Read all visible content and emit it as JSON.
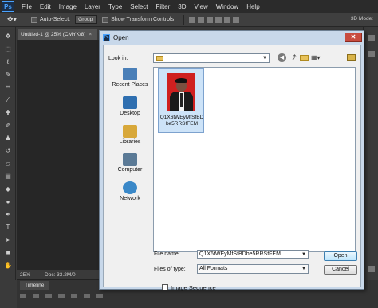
{
  "app": {
    "logo": "Ps",
    "menu": [
      "File",
      "Edit",
      "Image",
      "Layer",
      "Type",
      "Select",
      "Filter",
      "3D",
      "View",
      "Window",
      "Help"
    ]
  },
  "options_bar": {
    "auto_select_label": "Auto-Select:",
    "auto_select_value": "Group",
    "show_transform_label": "Show Transform Controls",
    "mode_3d_label": "3D Mode:"
  },
  "document": {
    "tab_title": "Untitled-1 @ 25% (CMYK/8)",
    "zoom": "25%",
    "doc_size": "Doc: 33.2M/0"
  },
  "timeline": {
    "tab_label": "Timeline"
  },
  "dialog": {
    "title": "Open",
    "close_glyph": "✕",
    "look_in_label": "Look in:",
    "look_in_value": "",
    "places": [
      {
        "label": "Recent Places",
        "icon": "recent-places-icon",
        "color": "#4a7fb8"
      },
      {
        "label": "Desktop",
        "icon": "desktop-icon",
        "color": "#2f6fb0"
      },
      {
        "label": "Libraries",
        "icon": "libraries-icon",
        "color": "#d8a83a"
      },
      {
        "label": "Computer",
        "icon": "computer-icon",
        "color": "#5b7a96"
      },
      {
        "label": "Network",
        "icon": "network-icon",
        "color": "#3a88c8"
      }
    ],
    "files": [
      {
        "name": "Q1X6tWEyMfSfBDbe5RRSfFEM",
        "selected": true
      }
    ],
    "file_name_label": "File name:",
    "file_name_value": "Q1X6tWEyMfSfBDbe5RRSfFEM",
    "file_type_label": "Files of type:",
    "file_type_value": "All Formats",
    "open_button": "Open",
    "cancel_button": "Cancel",
    "image_sequence_label": "Image Sequence",
    "image_sequence_checked": false
  },
  "colors": {
    "ps_blue": "#4aa3ff",
    "dialog_frame": "#c8d8ea",
    "selection": "#cde3f8",
    "close_red": "#c84b3e",
    "photo_background": "#cf2020"
  }
}
